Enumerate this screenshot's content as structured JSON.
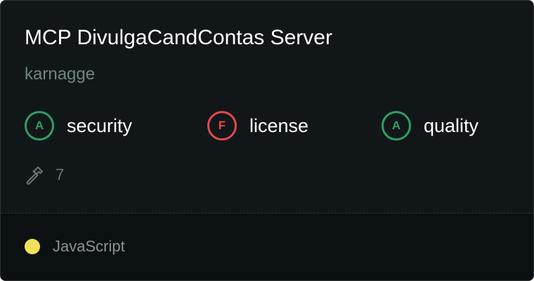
{
  "card": {
    "title": "MCP DivulgaCandContas Server",
    "author": "karnagge"
  },
  "grades": [
    {
      "letter": "A",
      "label": "security",
      "status": "pass"
    },
    {
      "letter": "F",
      "label": "license",
      "status": "fail"
    },
    {
      "letter": "A",
      "label": "quality",
      "status": "pass"
    }
  ],
  "tools": {
    "icon": "hammer-icon",
    "count": "7"
  },
  "language": {
    "name": "JavaScript",
    "color": "#f1e05a"
  },
  "colors": {
    "background": "#111719",
    "pass": "#2f9e63",
    "fail": "#e5484d",
    "author": "#6e8580"
  }
}
